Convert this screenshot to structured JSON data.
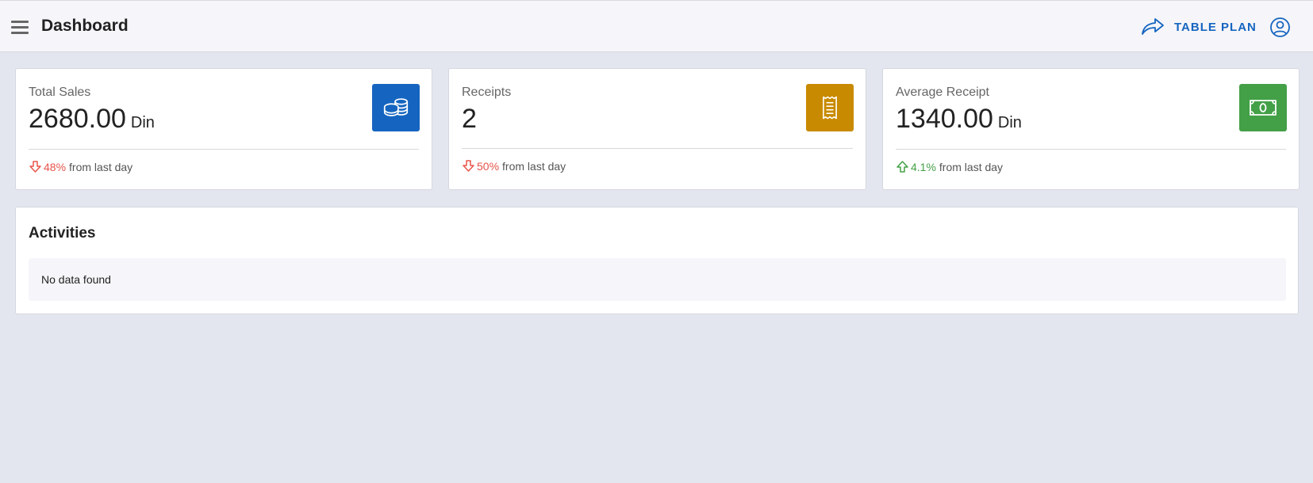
{
  "header": {
    "title": "Dashboard",
    "menu_icon": "hamburger-menu-icon",
    "table_plan_label": "TABLE PLAN",
    "table_plan_icon": "share-arrow-icon",
    "user_icon": "user-account-icon",
    "accent_color": "#1565c0"
  },
  "stats": [
    {
      "label": "Total Sales",
      "value": "2680.00",
      "unit": "Din",
      "icon": "coins-icon",
      "icon_color": "#1565c0",
      "trend": "down",
      "change": "48%",
      "change_suffix": "from last day"
    },
    {
      "label": "Receipts",
      "value": "2",
      "unit": "",
      "icon": "receipt-icon",
      "icon_color": "#c88a00",
      "trend": "down",
      "change": "50%",
      "change_suffix": "from last day"
    },
    {
      "label": "Average Receipt",
      "value": "1340.00",
      "unit": "Din",
      "icon": "banknote-icon",
      "icon_color": "#43a047",
      "trend": "up",
      "change": "4.1%",
      "change_suffix": "from last day"
    }
  ],
  "activities": {
    "title": "Activities",
    "empty_message": "No data found"
  }
}
